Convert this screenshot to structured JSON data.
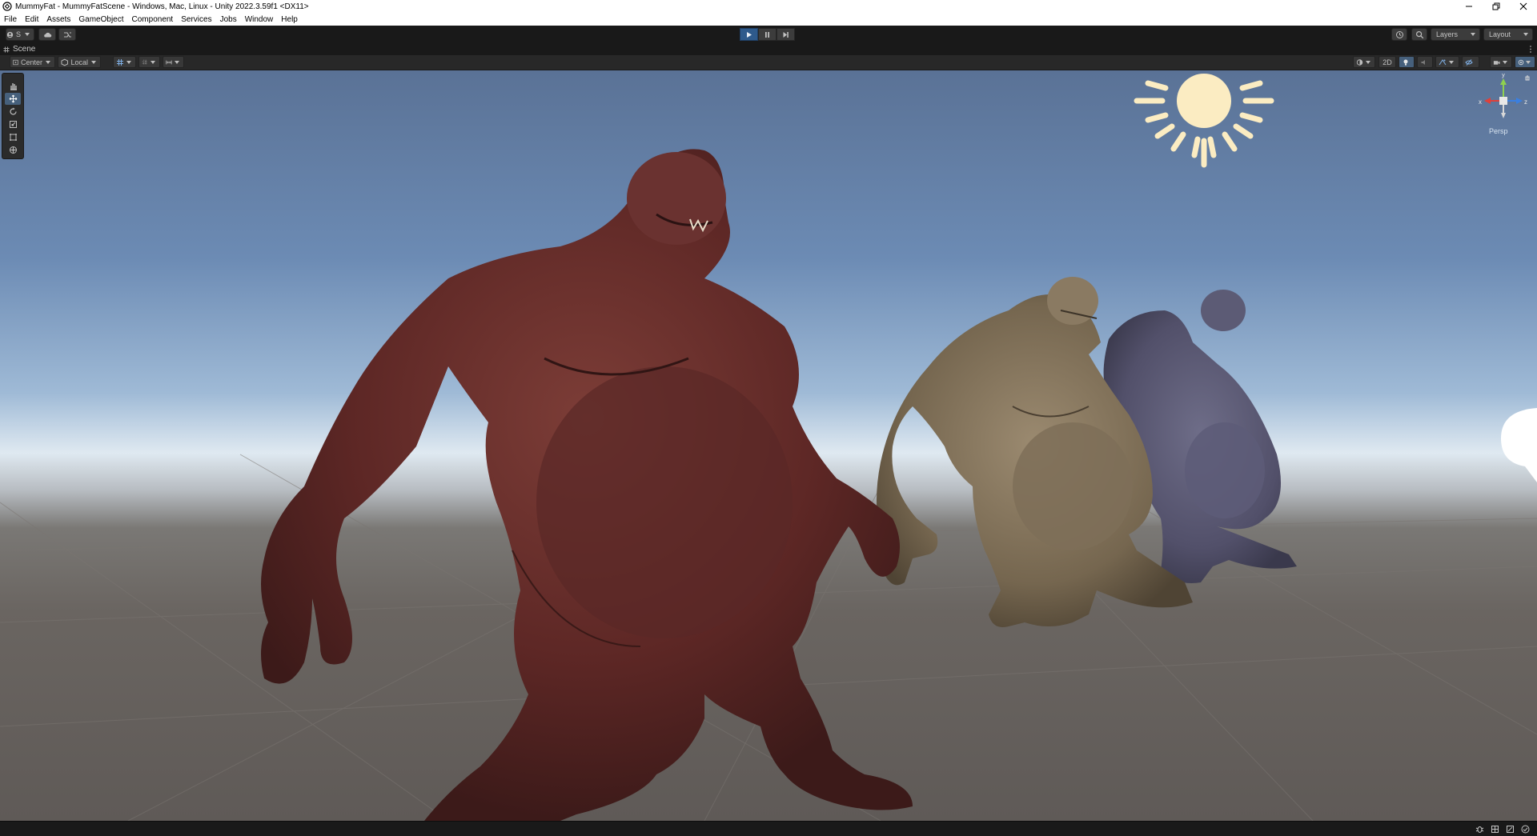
{
  "window": {
    "title": "MummyFat - MummyFatScene - Windows, Mac, Linux - Unity 2022.3.59f1 <DX11>",
    "icon": "unity-logo-icon",
    "controls": [
      "minimize-icon",
      "restore-icon",
      "close-icon"
    ]
  },
  "menubar": {
    "items": [
      "File",
      "Edit",
      "Assets",
      "GameObject",
      "Component",
      "Services",
      "Jobs",
      "Window",
      "Help"
    ]
  },
  "toolbar": {
    "account_label": "S",
    "cloud_icon": "cloud-icon",
    "collab_icon": "version-control-icon",
    "play": {
      "play_icon": "play-icon",
      "pause_icon": "pause-icon",
      "step_icon": "step-icon",
      "play_active": true
    },
    "history_icon": "history-icon",
    "search_icon": "search-icon",
    "layers_label": "Layers",
    "layout_label": "Layout"
  },
  "scene_tab": {
    "label": "Scene",
    "icon": "scene-hash-icon"
  },
  "scene_toolbar": {
    "pivot_label": "Center",
    "rotation_label": "Local",
    "mode_2d_label": "2D",
    "icons": [
      "grid-snap-icon",
      "grid-icon",
      "increment-snap-icon",
      "shading-mode-icon",
      "lighting-icon",
      "audio-icon",
      "effects-icon",
      "visibility-icon",
      "camera-icon",
      "gizmos-icon"
    ]
  },
  "tools": [
    "hand-tool-icon",
    "move-tool-icon",
    "rotate-tool-icon",
    "scale-tool-icon",
    "rect-tool-icon",
    "transform-tool-icon"
  ],
  "active_tool": "move-tool-icon",
  "gizmo": {
    "x_label": "x",
    "z_label": "z",
    "y_label": "y",
    "projection_label": "Persp"
  },
  "status_icons": [
    "bug-icon",
    "lighting-status-icon",
    "cache-icon",
    "checkmark-icon"
  ],
  "colors": {
    "accent_play": "#2e5a8c",
    "sky_top": "#5a7296",
    "horizon": "#dfe9f1",
    "ground": "#6a6561",
    "sun_gizmo": "#fbecc2",
    "creature_red": "#6b2f2c",
    "creature_tan": "#8a7a62",
    "creature_blue": "#5a5a75"
  }
}
